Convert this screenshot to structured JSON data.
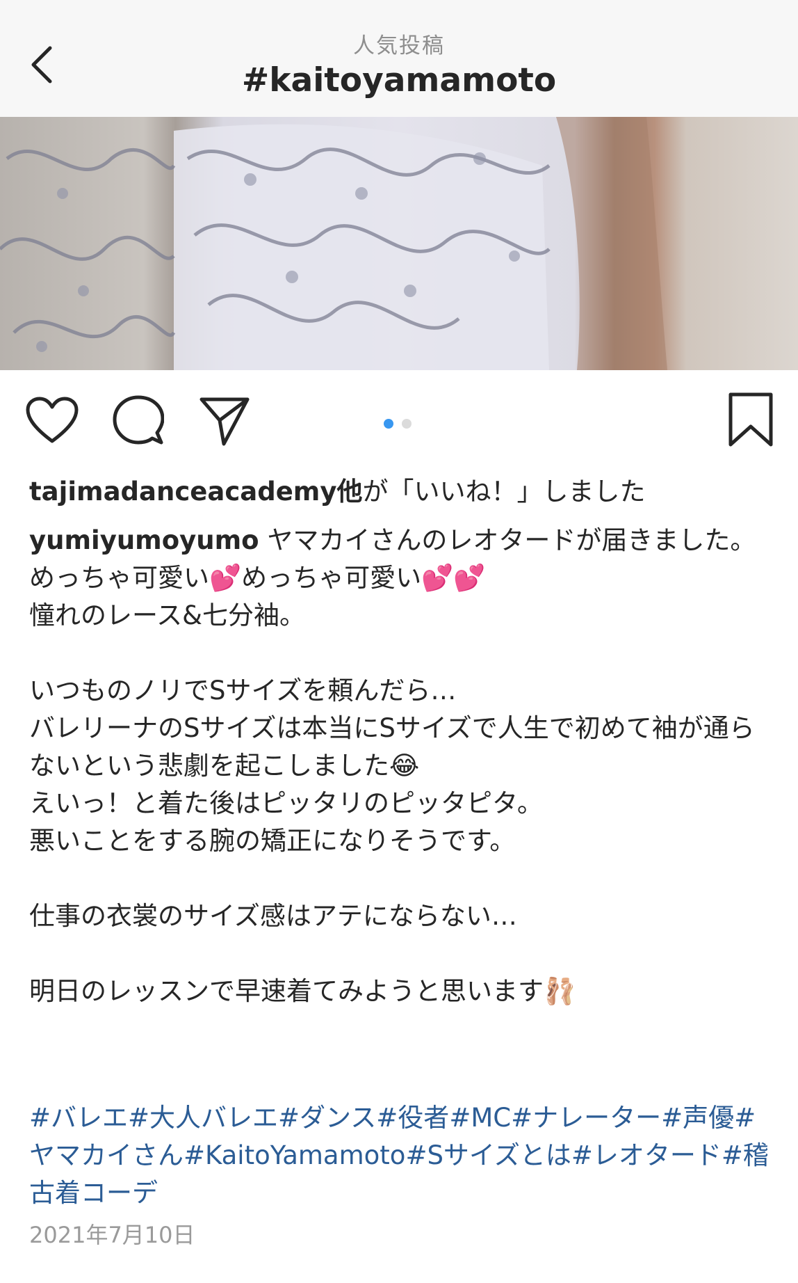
{
  "header": {
    "subtitle": "人気投稿",
    "title": "#kaitoyamamoto"
  },
  "icons": {
    "back": "chevron-left-icon",
    "like": "heart-icon",
    "comment": "comment-icon",
    "share": "paper-plane-icon",
    "save": "bookmark-icon"
  },
  "carousel": {
    "current": 1,
    "total": 2
  },
  "likes": {
    "user": "tajimadanceacademy他",
    "text": "が「いいね！」しました"
  },
  "caption": {
    "user": "yumiyumoyumo",
    "lines": [
      " ヤマカイさんのレオタードが届きました。",
      "めっちゃ可愛い💕めっちゃ可愛い💕💕",
      "憧れのレース&七分袖。",
      "",
      "いつものノリでSサイズを頼んだら…",
      "バレリーナのSサイズは本当にSサイズで人生で初めて袖が通らないという悲劇を起こしました😂",
      "えいっ！と着た後はピッタリのピッタピタ。",
      "悪いことをする腕の矯正になりそうです。",
      "",
      "仕事の衣裳のサイズ感はアテにならない…",
      "",
      "明日のレッスンで早速着てみようと思います🩰"
    ]
  },
  "hashtags": [
    "#バレエ",
    "#大人バレエ",
    "#ダンス",
    "#役者",
    "#MC",
    "#ナレーター",
    "#声優",
    "#ヤマカイさん",
    "#KaitoYamamoto",
    "#Sサイズとは",
    "#レオタード",
    "#稽古着コーデ"
  ],
  "date": "2021年7月10日",
  "colors": {
    "link": "#2b5c95",
    "dot_active": "#3897f0",
    "dot_inactive": "#dbdbdb",
    "header_bg": "#f7f7f7"
  }
}
